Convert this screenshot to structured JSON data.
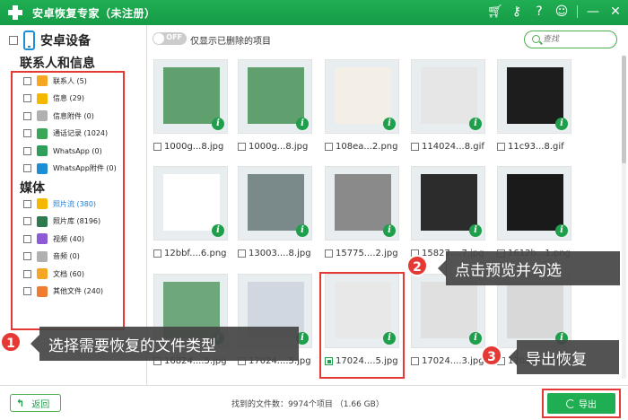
{
  "app": {
    "title": "安卓恢复专家（未注册）"
  },
  "titlebar_icons": [
    "cart-icon",
    "key-icon",
    "help-icon",
    "chat-icon",
    "minimize-icon",
    "close-icon"
  ],
  "sidebar": {
    "device_label": "安卓设备",
    "contacts_section": "联系人和信息",
    "media_section": "媒体",
    "contacts_items": [
      {
        "label": "联系人 (5)",
        "icon": "contacts-icon",
        "color": "#f5a623"
      },
      {
        "label": "信息 (29)",
        "icon": "message-icon",
        "color": "#f5b800"
      },
      {
        "label": "信息附件 (0)",
        "icon": "attachment-icon",
        "color": "#b0b0b0"
      },
      {
        "label": "通话记录 (1024)",
        "icon": "call-log-icon",
        "color": "#3aa757"
      },
      {
        "label": "WhatsApp (0)",
        "icon": "whatsapp-icon",
        "color": "#2e9e5b"
      },
      {
        "label": "WhatsApp附件 (0)",
        "icon": "whatsapp-attachment-icon",
        "color": "#1c8ed6"
      }
    ],
    "media_items": [
      {
        "label": "照片流 (380)",
        "icon": "photo-stream-icon",
        "color": "#f5b800",
        "active": true
      },
      {
        "label": "照片库 (8196)",
        "icon": "photo-library-icon",
        "color": "#2d7a4f"
      },
      {
        "label": "视频 (40)",
        "icon": "video-icon",
        "color": "#8e5bd6"
      },
      {
        "label": "音频 (0)",
        "icon": "audio-icon",
        "color": "#b0b0b0"
      },
      {
        "label": "文档 (60)",
        "icon": "document-icon",
        "color": "#f5a623"
      },
      {
        "label": "其他文件 (240)",
        "icon": "other-files-icon",
        "color": "#f07d2f"
      }
    ]
  },
  "filter": {
    "toggle_label": "OFF",
    "label": "仅显示已删除的项目",
    "search_placeholder": "查找"
  },
  "grid": {
    "rows": [
      [
        {
          "name": "1000g...8.jpg",
          "bg": "#5fa06e"
        },
        {
          "name": "1000g...8.jpg",
          "bg": "#5fa06e"
        },
        {
          "name": "108ea...2.png",
          "bg": "#f4efe6"
        },
        {
          "name": "114024...8.gif",
          "bg": "#e6e6e6"
        },
        {
          "name": "11c93...8.gif",
          "bg": "#1d1d1d"
        }
      ],
      [
        {
          "name": "12bbf....6.png",
          "bg": "#ffffff"
        },
        {
          "name": "13003....8.jpg",
          "bg": "#7a8a8a"
        },
        {
          "name": "15775....2.jpg",
          "bg": "#8a8a8a"
        },
        {
          "name": "15827....7.jpg",
          "bg": "#2c2c2c"
        },
        {
          "name": "1612b...1.png",
          "bg": "#1a1a1a"
        }
      ],
      [
        {
          "name": "16824....5.jpg",
          "bg": "#6fa77c"
        },
        {
          "name": "17024....5.jpg",
          "bg": "#d0d7e0"
        },
        {
          "name": "17024....5.jpg",
          "bg": "#e8e8e8",
          "checked": true
        },
        {
          "name": "17024....3.jpg",
          "bg": "#e0e0e0"
        },
        {
          "name": "17024....5.jpg",
          "bg": "#d8d8d8"
        }
      ]
    ]
  },
  "callouts": [
    {
      "step": "1",
      "text": "选择需要恢复的文件类型"
    },
    {
      "step": "2",
      "text": "点击预览并勾选"
    },
    {
      "step": "3",
      "text": "导出恢复"
    }
  ],
  "bottom": {
    "back_label": "返回",
    "found_text": "找到的文件数：9974个项目 （1.66 GB）",
    "export_label": "导出"
  },
  "colors": {
    "brand": "#1fae52",
    "highlight": "#e53935",
    "info": "#1f9e4b"
  }
}
